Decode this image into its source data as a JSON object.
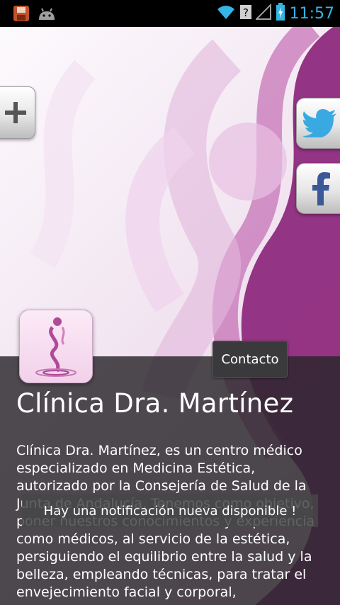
{
  "status_bar": {
    "time": "11:57",
    "left_icons": [
      "save-notification-icon",
      "android-icon"
    ],
    "right_icons": [
      "wifi-icon",
      "unknown-signal-icon",
      "cell-signal-icon",
      "battery-charging-icon"
    ],
    "accent": "#33b5e5"
  },
  "side_buttons": {
    "plus_icon": "plus-icon",
    "twitter_icon": "twitter-bird-icon",
    "facebook_icon": "facebook-f-icon"
  },
  "contact_button": {
    "label": "Contacto"
  },
  "clinic": {
    "title": "Clínica Dra. Martínez",
    "description": "Clínica Dra. Martínez, es un centro médico especializado en Medicina Estética, autorizado por la Consejería de Salud de la Junta de Andalucía. Tenemos como objetivo, poner nuestros conocimientos y experiencia como médicos, al servicio de la estética, persiguiendo el equilibrio entre la salud y la belleza, empleando técnicas, para tratar el envejecimiento facial y corporal,"
  },
  "toast": {
    "message": "Hay una notificación nueva disponible !"
  },
  "colors": {
    "brand_purple": "#8e2a7d",
    "panel_dark": "#28262a"
  }
}
